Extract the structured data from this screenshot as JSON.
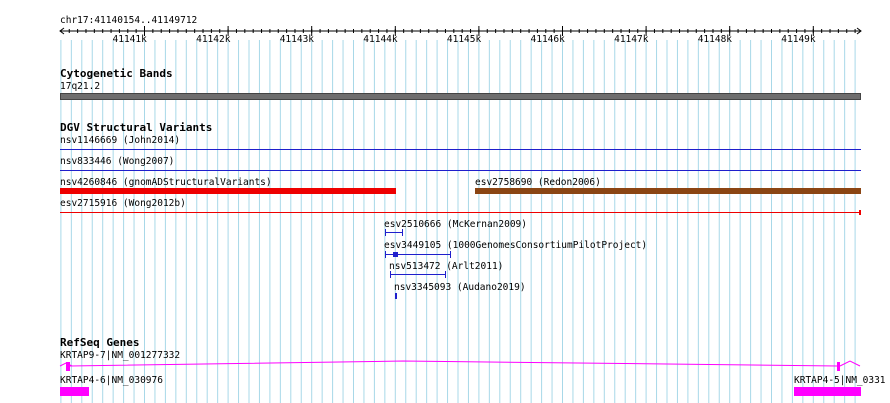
{
  "ruler": {
    "position_label": "chr17:41140154..41149712",
    "ticks": [
      "41141k",
      "41142k",
      "41143k",
      "41144k",
      "41145k",
      "41146k",
      "41147k",
      "41148k",
      "41149k"
    ]
  },
  "cytoband": {
    "title": "Cytogenetic Bands",
    "band_label": "17q21.2",
    "band_color": "#6e6e6e"
  },
  "dgv": {
    "title": "DGV Structural Variants",
    "variants": [
      {
        "id": "nsv1146669",
        "source": "nsv1146669 (John2014)",
        "color": "#1f1fcc",
        "style": "line"
      },
      {
        "id": "nsv833446",
        "source": "nsv833446 (Wong2007)",
        "color": "#1f1fcc",
        "style": "line"
      },
      {
        "id": "nsv4260846",
        "source": "nsv4260846 (gnomADStructuralVariants)",
        "color": "#ee0000",
        "style": "bar"
      },
      {
        "id": "esv2758690",
        "source": "esv2758690 (Redon2006)",
        "color": "#8b4513",
        "style": "bar"
      },
      {
        "id": "esv2715916",
        "source": "esv2715916 (Wong2012b)",
        "color": "#ee0000",
        "style": "line"
      },
      {
        "id": "esv2510666",
        "source": "esv2510666 (McKernan2009)",
        "color": "#1f1fcc",
        "style": "small"
      },
      {
        "id": "esv3449105",
        "source": "esv3449105 (1000GenomesConsortiumPilotProject)",
        "color": "#1f1fcc",
        "style": "small"
      },
      {
        "id": "nsv513472",
        "source": "nsv513472 (Arlt2011)",
        "color": "#1f1fcc",
        "style": "small"
      },
      {
        "id": "nsv3345093",
        "source": "nsv3345093 (Audano2019)",
        "color": "#1f1fcc",
        "style": "small"
      }
    ]
  },
  "refseq": {
    "title": "RefSeq Genes",
    "genes": [
      {
        "label": "KRTAP9-7|NM_001277332",
        "color": "#ff00ff"
      },
      {
        "label": "KRTAP4-6|NM_030976",
        "color": "#ff00ff"
      },
      {
        "label": "KRTAP4-5|NM_0331",
        "color": "#ff00ff"
      }
    ]
  },
  "colors": {
    "grid": "#a8d8e8",
    "ruler": "#000000",
    "magenta": "#ff00ff"
  }
}
